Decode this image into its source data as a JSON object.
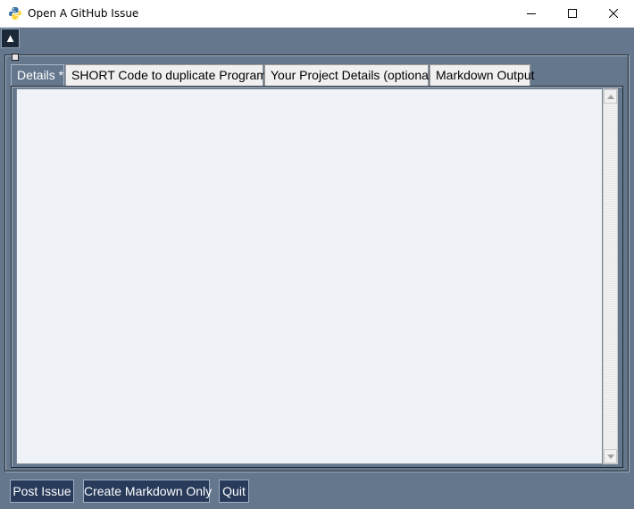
{
  "window": {
    "title": "Open A GitHub Issue",
    "icon": "python-icon"
  },
  "controls": {
    "minimize_icon": "minimize-icon",
    "maximize_icon": "maximize-icon",
    "close_icon": "close-icon",
    "collapse_glyph": "▲"
  },
  "tabs": [
    {
      "label": "Details *",
      "active": true
    },
    {
      "label": "SHORT Code to duplicate Program *",
      "active": false
    },
    {
      "label": "Your Project Details (optional)",
      "active": false
    },
    {
      "label": "Markdown Output",
      "active": false
    }
  ],
  "details": {
    "text": ""
  },
  "buttons": {
    "post": "Post Issue",
    "markdown": "Create Markdown Only",
    "quit": "Quit"
  },
  "colors": {
    "background": "#64778d",
    "button_bg": "#283b5b",
    "textarea_bg": "#eff3f7"
  }
}
